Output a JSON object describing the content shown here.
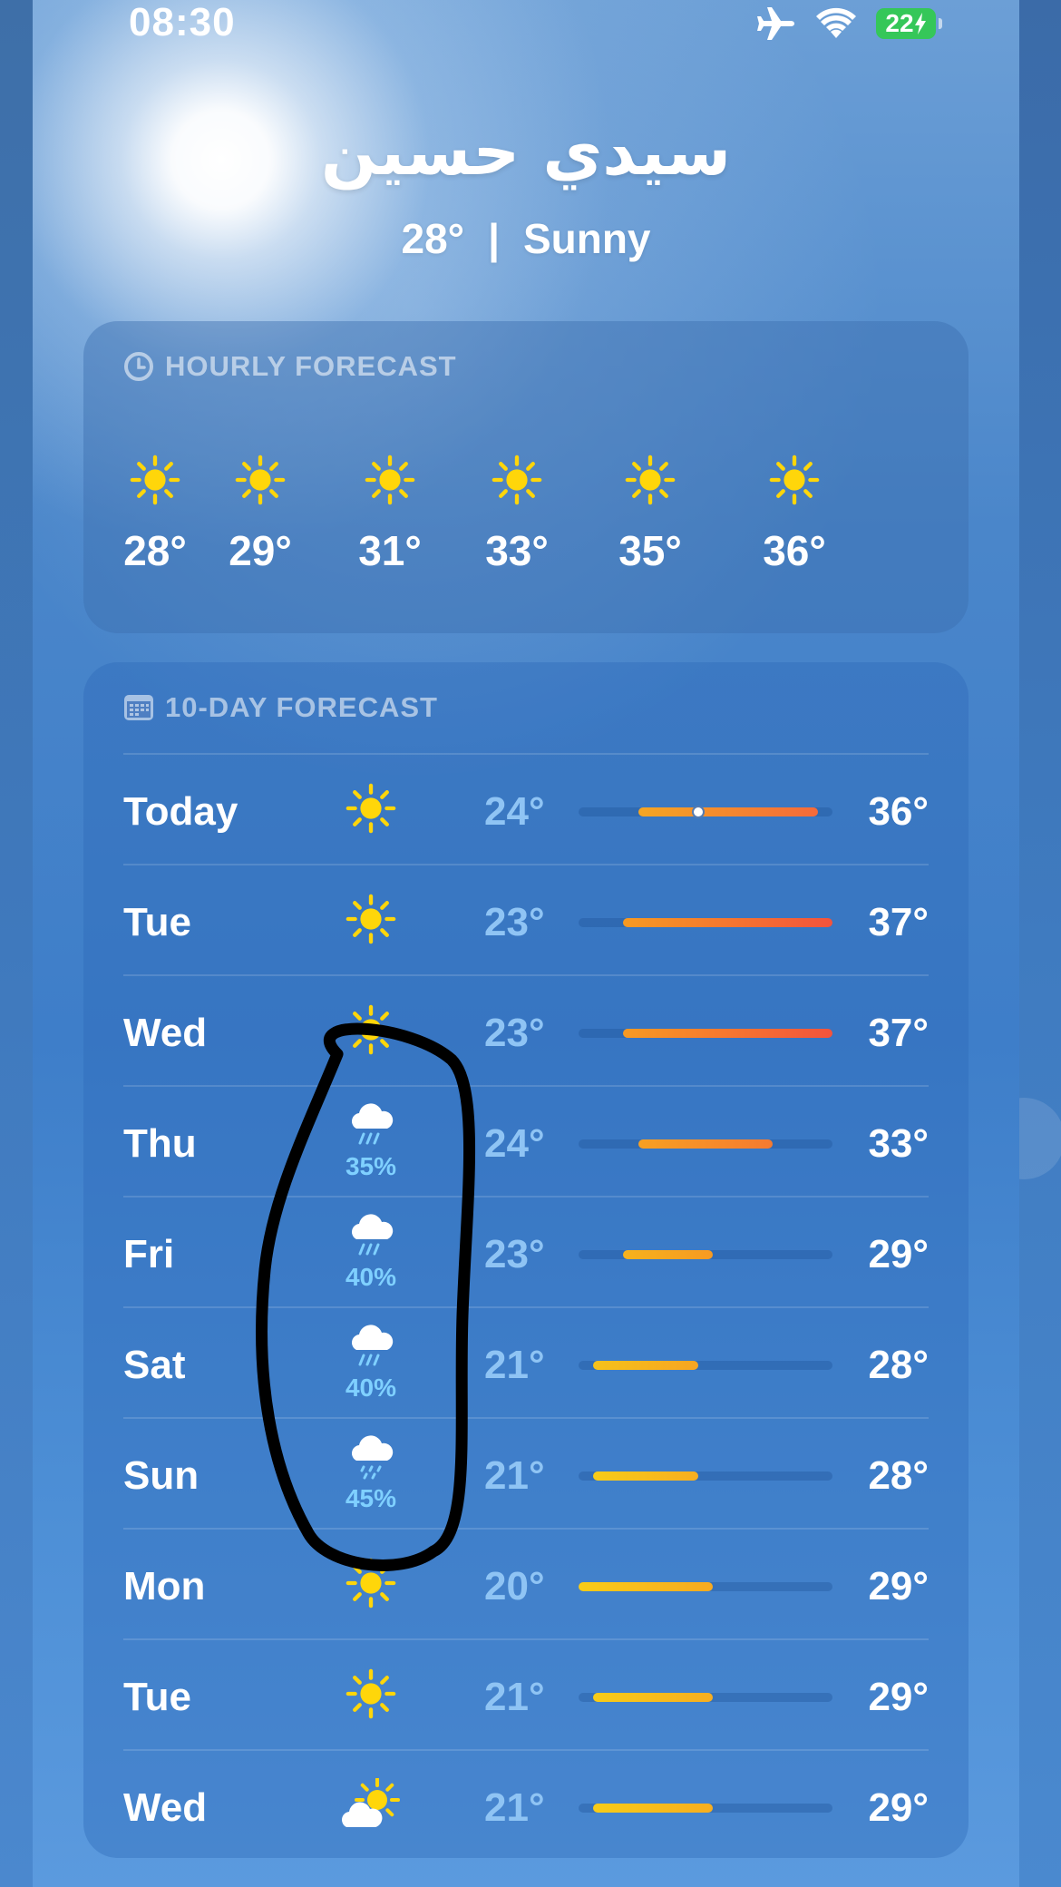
{
  "status_bar": {
    "time": "08:30",
    "battery": "22"
  },
  "location": {
    "city": "سيدي حسين",
    "current_temp": "28°",
    "condition": "Sunny"
  },
  "hourly": {
    "title": "HOURLY FORECAST",
    "items": [
      {
        "icon": "sun-icon",
        "temp": "28°"
      },
      {
        "icon": "sun-icon",
        "temp": "29°"
      },
      {
        "icon": "sun-icon",
        "temp": "31°"
      },
      {
        "icon": "sun-icon",
        "temp": "33°"
      },
      {
        "icon": "sun-icon",
        "temp": "35°"
      },
      {
        "icon": "sun-icon",
        "temp": "36°"
      }
    ]
  },
  "daily": {
    "title": "10-DAY FORECAST",
    "range": {
      "min": 20,
      "max": 37
    },
    "current_temp_value": 28,
    "days": [
      {
        "day": "Today",
        "icon": "sun-icon",
        "precip": "",
        "low": "24°",
        "high": "36°",
        "low_value": 24,
        "high_value": 36,
        "colors": [
          "#f5a623",
          "#f56a3a"
        ],
        "current": true
      },
      {
        "day": "Tue",
        "icon": "sun-icon",
        "precip": "",
        "low": "23°",
        "high": "37°",
        "low_value": 23,
        "high_value": 37,
        "colors": [
          "#f79a22",
          "#f4533c"
        ]
      },
      {
        "day": "Wed",
        "icon": "sun-icon",
        "precip": "",
        "low": "23°",
        "high": "37°",
        "low_value": 23,
        "high_value": 37,
        "colors": [
          "#f79a22",
          "#f4533c"
        ]
      },
      {
        "day": "Thu",
        "icon": "rain-cloud-icon",
        "precip": "35%",
        "low": "24°",
        "high": "33°",
        "low_value": 24,
        "high_value": 33,
        "colors": [
          "#f7a022",
          "#f57a30"
        ]
      },
      {
        "day": "Fri",
        "icon": "rain-cloud-icon",
        "precip": "40%",
        "low": "23°",
        "high": "29°",
        "low_value": 23,
        "high_value": 29,
        "colors": [
          "#f7b21c",
          "#f79a22"
        ]
      },
      {
        "day": "Sat",
        "icon": "rain-cloud-icon",
        "precip": "40%",
        "low": "21°",
        "high": "28°",
        "low_value": 21,
        "high_value": 28,
        "colors": [
          "#f6c21a",
          "#f7a522"
        ]
      },
      {
        "day": "Sun",
        "icon": "drizzle-cloud-icon",
        "precip": "45%",
        "low": "21°",
        "high": "28°",
        "low_value": 21,
        "high_value": 28,
        "colors": [
          "#f8cc18",
          "#f7ae20"
        ]
      },
      {
        "day": "Mon",
        "icon": "sun-icon",
        "precip": "",
        "low": "20°",
        "high": "29°",
        "low_value": 20,
        "high_value": 29,
        "colors": [
          "#f8cc18",
          "#f7aa20"
        ]
      },
      {
        "day": "Tue",
        "icon": "sun-icon",
        "precip": "",
        "low": "21°",
        "high": "29°",
        "low_value": 21,
        "high_value": 29,
        "colors": [
          "#f8cc18",
          "#f7ae20"
        ]
      },
      {
        "day": "Wed",
        "icon": "partly-cloudy-icon",
        "precip": "",
        "low": "21°",
        "high": "29°",
        "low_value": 21,
        "high_value": 29,
        "colors": [
          "#f8cc18",
          "#f7ae20"
        ]
      }
    ]
  },
  "colors": {
    "sun": "#ffd60a",
    "precip": "#7fd0ff",
    "low_temp": "#8fc4f4",
    "battery": "#35c759"
  }
}
